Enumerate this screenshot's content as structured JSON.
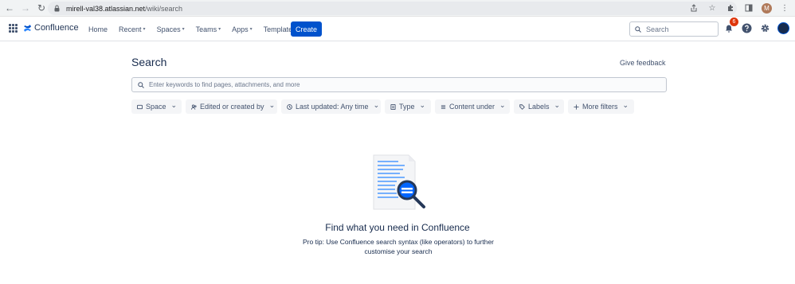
{
  "browser": {
    "url_host": "mirell-val38.atlassian.net",
    "url_path": "/wiki/search",
    "profile_initial": "M"
  },
  "topnav": {
    "logo_text": "Confluence",
    "items": [
      {
        "label": "Home",
        "has_dropdown": false
      },
      {
        "label": "Recent",
        "has_dropdown": true
      },
      {
        "label": "Spaces",
        "has_dropdown": true
      },
      {
        "label": "Teams",
        "has_dropdown": true
      },
      {
        "label": "Apps",
        "has_dropdown": true
      },
      {
        "label": "Templates",
        "has_dropdown": false
      }
    ],
    "create_label": "Create",
    "search_placeholder": "Search",
    "notification_count": "6"
  },
  "page": {
    "title": "Search",
    "give_feedback": "Give feedback",
    "search_placeholder": "Enter keywords to find pages, attachments, and more"
  },
  "filters": [
    {
      "label": "Space",
      "icon": "space-icon"
    },
    {
      "label": "Edited or created by",
      "icon": "people-icon"
    },
    {
      "label": "Last updated: Any time",
      "icon": "clock-icon"
    },
    {
      "label": "Type",
      "icon": "document-icon"
    },
    {
      "label": "Content under",
      "icon": "list-icon"
    },
    {
      "label": "Labels",
      "icon": "tag-icon"
    },
    {
      "label": "More filters",
      "icon": "plus-icon"
    }
  ],
  "empty_state": {
    "title": "Find what you need in Confluence",
    "tip": "Pro tip: Use Confluence search syntax (like operators) to further customise your search"
  },
  "colors": {
    "brand": "#0052cc",
    "badge": "#de350b"
  }
}
